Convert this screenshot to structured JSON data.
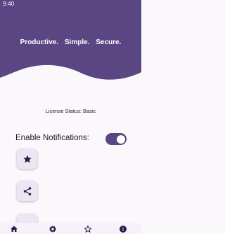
{
  "status_bar": {
    "time": "9:40"
  },
  "header": {
    "tagline": "Productive. Simple. Secure.",
    "color": "#5a4682"
  },
  "license": {
    "text": "License Status: Basic"
  },
  "settings": {
    "notifications_label": "Enable Notifications:",
    "notifications_enabled": true
  },
  "actions": [
    {
      "icon": "star-icon"
    },
    {
      "icon": "share-icon"
    },
    {
      "icon": "unknown-icon"
    }
  ],
  "bottom_nav": [
    {
      "icon": "home-icon",
      "selected": true
    },
    {
      "icon": "settings-icon",
      "selected": false
    },
    {
      "icon": "star-outline-icon",
      "selected": false
    },
    {
      "icon": "info-icon",
      "selected": false
    }
  ],
  "colors": {
    "accent": "#5a4682",
    "background": "#fbf8fc",
    "fab_bg": "#ece6f4",
    "icon": "#2a1b4a"
  }
}
